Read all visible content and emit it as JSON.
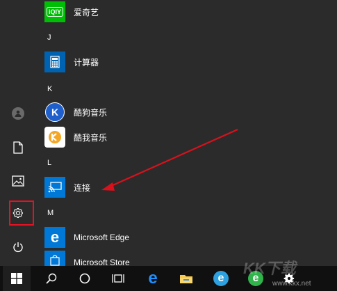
{
  "start_menu": {
    "sections": [
      {
        "letter": "",
        "apps": [
          {
            "name": "爱奇艺",
            "icon": "iqiyi-icon",
            "color": "#00be06"
          }
        ]
      },
      {
        "letter": "J",
        "apps": [
          {
            "name": "计算器",
            "icon": "calculator-icon",
            "color": "#0063b1"
          }
        ]
      },
      {
        "letter": "K",
        "apps": [
          {
            "name": "酷狗音乐",
            "icon": "kugou-music-icon",
            "color": "#1e5fcc"
          },
          {
            "name": "酷我音乐",
            "icon": "kuwo-music-icon",
            "color": "#f5a623"
          }
        ]
      },
      {
        "letter": "L",
        "apps": [
          {
            "name": "连接",
            "icon": "connect-icon",
            "color": "#0078d7"
          }
        ]
      },
      {
        "letter": "M",
        "apps": [
          {
            "name": "Microsoft Edge",
            "icon": "edge-icon",
            "color": "#0078d7"
          },
          {
            "name": "Microsoft Store",
            "icon": "store-icon",
            "color": "#0078d7"
          }
        ]
      }
    ]
  },
  "left_rail": [
    "user-avatar-icon",
    "document-icon",
    "pictures-icon",
    "settings-icon",
    "power-icon"
  ],
  "taskbar": [
    "windows-start-icon",
    "search-icon",
    "cortana-icon",
    "task-view-icon",
    "edge-icon",
    "file-explorer-icon",
    "ie-icon",
    "360-browser-icon",
    "settings-icon"
  ],
  "annotation": {
    "highlight_color": "#e81123",
    "arrow_color": "#d9111c"
  },
  "watermark": {
    "text": "KK下载",
    "url": "www.kkx.net"
  }
}
